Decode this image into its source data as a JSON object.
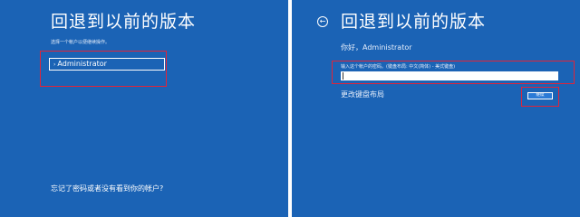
{
  "left_panel": {
    "title": "回退到以前的版本",
    "instruction": "选择一个帐户以便继续操作。",
    "account": {
      "chevron": "›",
      "name": "Administrator"
    },
    "forgot_link": "忘记了密码或者没有看到你的帐户?"
  },
  "right_panel": {
    "back_icon": "←",
    "title": "回退到以前的版本",
    "greeting": "你好，Administrator",
    "password_label": "输入这个帐户的密码。(键盘布局: 中文(简体) - 美式键盘)",
    "password_value": "",
    "change_keyboard": "更改键盘布局",
    "continue_label": "继续"
  },
  "colors": {
    "background": "#1b63b5",
    "highlight": "#e0243a",
    "button": "#2b7ad6"
  }
}
